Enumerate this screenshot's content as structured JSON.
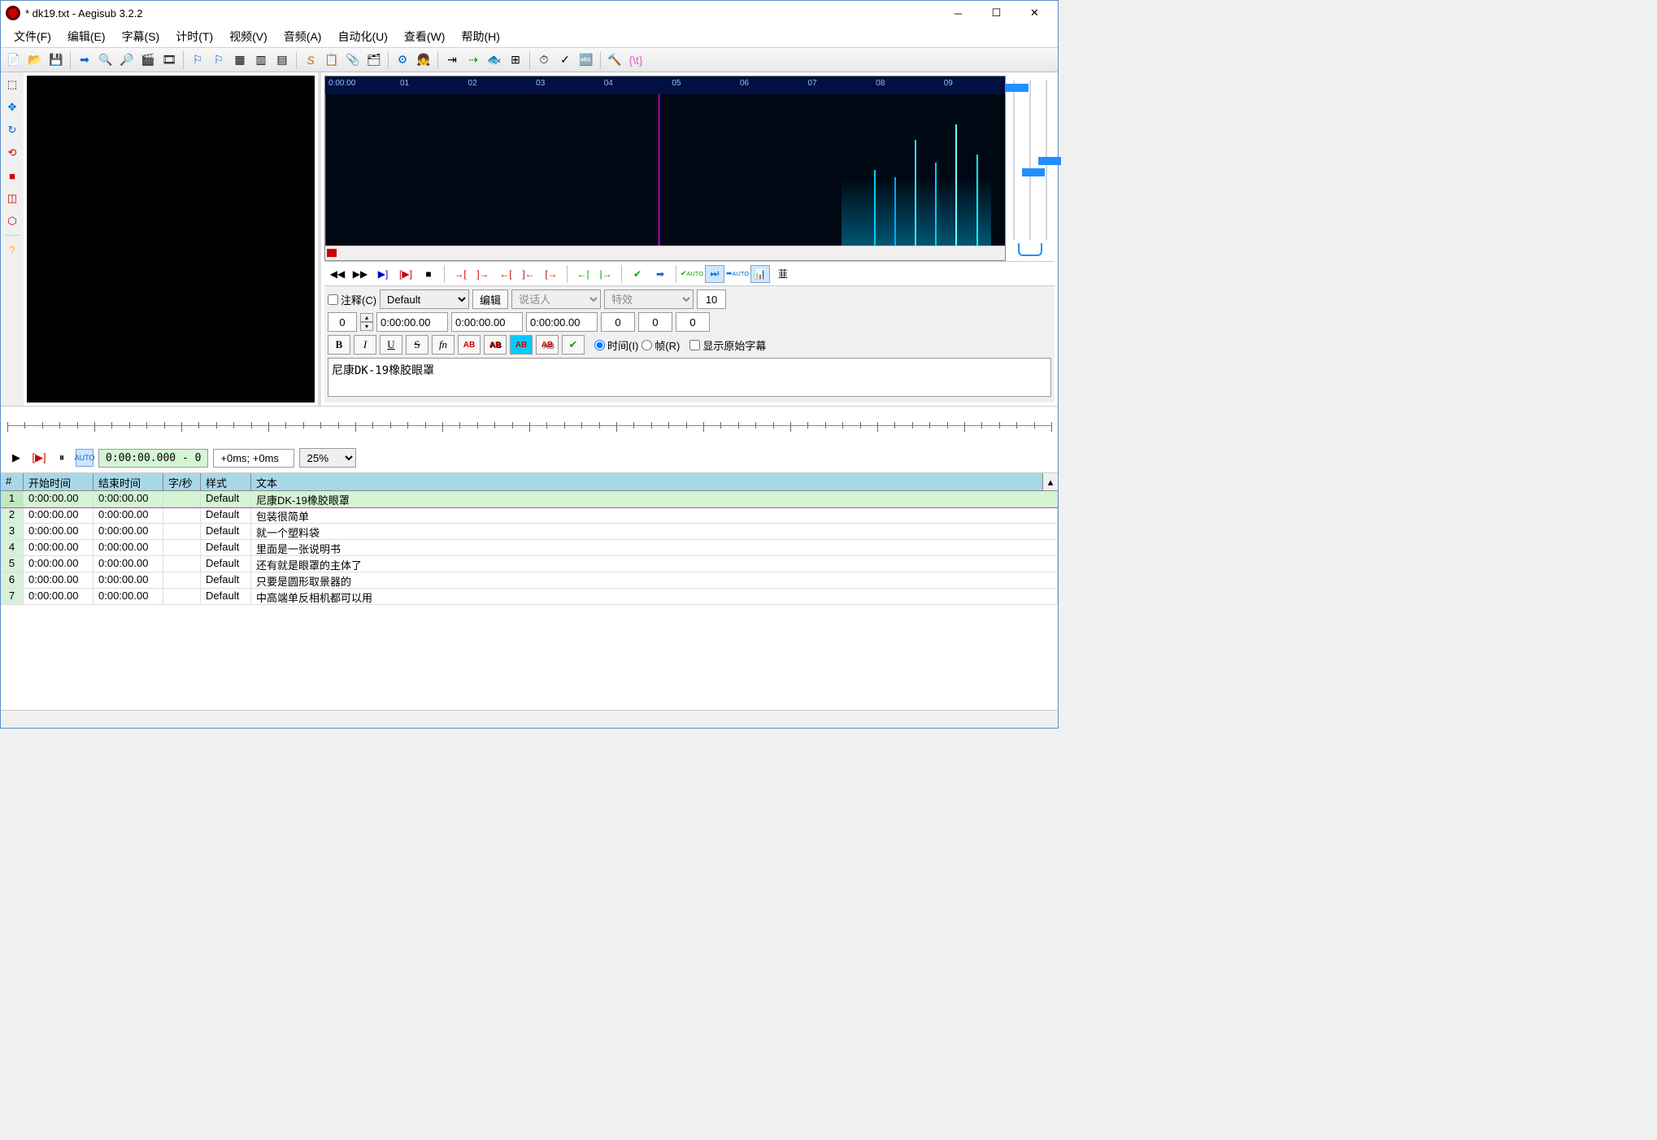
{
  "title": "* dk19.txt - Aegisub 3.2.2",
  "menu": [
    "文件(F)",
    "编辑(E)",
    "字幕(S)",
    "计时(T)",
    "视频(V)",
    "音频(A)",
    "自动化(U)",
    "查看(W)",
    "帮助(H)"
  ],
  "timeline_labels": [
    "0:00:00",
    "01",
    "02",
    "03",
    "04",
    "05",
    "06",
    "07",
    "08",
    "09"
  ],
  "edit": {
    "comment_label": "注释(C)",
    "style": "Default",
    "edit_btn": "编辑",
    "actor_placeholder": "说话人",
    "effect_placeholder": "特效",
    "margin_r": "10",
    "layer": "0",
    "start": "0:00:00.00",
    "end": "0:00:00.00",
    "duration": "0:00:00.00",
    "margin_l": "0",
    "margin_v1": "0",
    "margin_v2": "0",
    "time_radio": "时间(I)",
    "frame_radio": "帧(R)",
    "show_orig": "显示原始字幕",
    "text": "尼康DK-19橡胶眼罩"
  },
  "video_ctrl": {
    "time": "0:00:00.000 - 0",
    "offset": "+0ms; +0ms",
    "zoom": "25%"
  },
  "grid": {
    "headers": [
      "#",
      "开始时间",
      "结束时间",
      "字/秒",
      "样式",
      "文本"
    ],
    "rows": [
      {
        "n": "1",
        "start": "0:00:00.00",
        "end": "0:00:00.00",
        "cps": "",
        "style": "Default",
        "text": "尼康DK-19橡胶眼罩",
        "sel": true
      },
      {
        "n": "2",
        "start": "0:00:00.00",
        "end": "0:00:00.00",
        "cps": "",
        "style": "Default",
        "text": "包装很简单",
        "sel": false
      },
      {
        "n": "3",
        "start": "0:00:00.00",
        "end": "0:00:00.00",
        "cps": "",
        "style": "Default",
        "text": "就一个塑料袋",
        "sel": false
      },
      {
        "n": "4",
        "start": "0:00:00.00",
        "end": "0:00:00.00",
        "cps": "",
        "style": "Default",
        "text": "里面是一张说明书",
        "sel": false
      },
      {
        "n": "5",
        "start": "0:00:00.00",
        "end": "0:00:00.00",
        "cps": "",
        "style": "Default",
        "text": "还有就是眼罩的主体了",
        "sel": false
      },
      {
        "n": "6",
        "start": "0:00:00.00",
        "end": "0:00:00.00",
        "cps": "",
        "style": "Default",
        "text": "只要是圆形取景器的",
        "sel": false
      },
      {
        "n": "7",
        "start": "0:00:00.00",
        "end": "0:00:00.00",
        "cps": "",
        "style": "Default",
        "text": "中高端单反相机都可以用",
        "sel": false
      }
    ]
  }
}
